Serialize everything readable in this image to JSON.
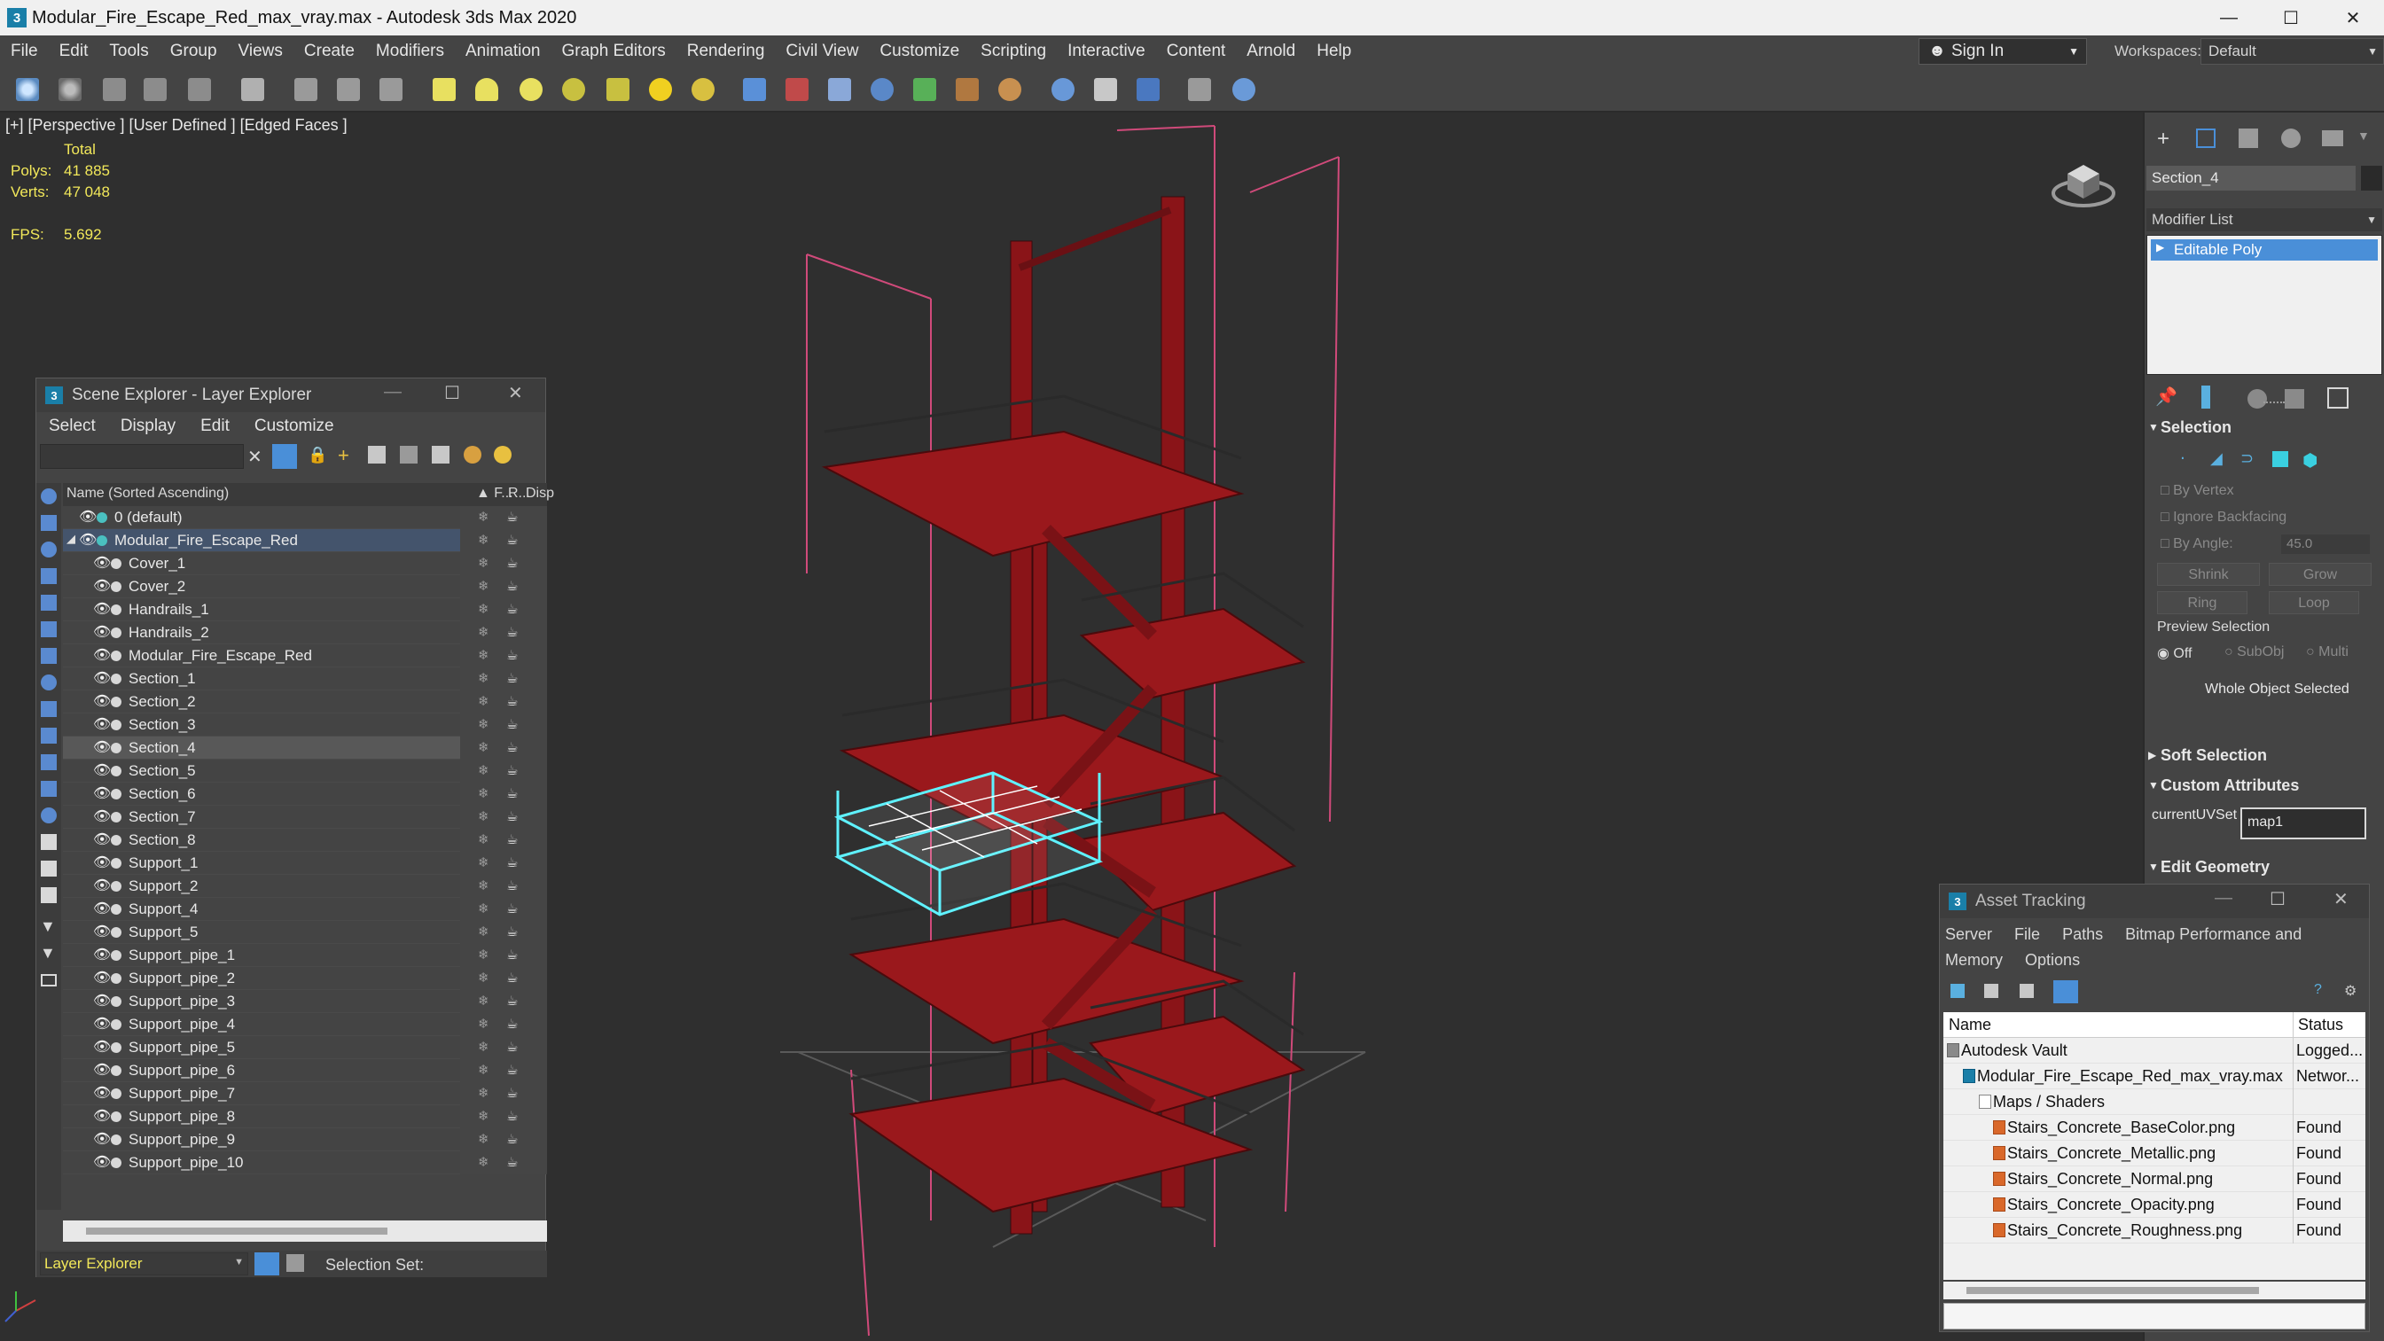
{
  "window": {
    "title": "Modular_Fire_Escape_Red_max_vray.max - Autodesk 3ds Max 2020",
    "app_icon": "3"
  },
  "menubar": {
    "items": [
      "File",
      "Edit",
      "Tools",
      "Group",
      "Views",
      "Create",
      "Modifiers",
      "Animation",
      "Graph Editors",
      "Rendering",
      "Civil View",
      "Customize",
      "Scripting",
      "Interactive",
      "Content",
      "Arnold",
      "Help"
    ],
    "sign_in": "Sign In",
    "workspaces_label": "Workspaces:",
    "workspace_value": "Default"
  },
  "viewport": {
    "label": "[+] [Perspective ] [User Defined ] [Edged Faces ]",
    "stats_total": "Total",
    "polys_label": "Polys:",
    "polys_value": "41 885",
    "verts_label": "Verts:",
    "verts_value": "47 048",
    "fps_label": "FPS:",
    "fps_value": "5.692"
  },
  "command_panel": {
    "object_name": "Section_4",
    "modifier_list": "Modifier List",
    "stack_item": "Editable Poly",
    "selection_rollout": "Selection",
    "by_vertex": "By Vertex",
    "ignore_backfacing": "Ignore Backfacing",
    "by_angle": "By Angle:",
    "by_angle_value": "45.0",
    "shrink": "Shrink",
    "grow": "Grow",
    "ring": "Ring",
    "loop": "Loop",
    "preview_selection": "Preview Selection",
    "preview_off": "Off",
    "preview_subobj": "SubObj",
    "preview_multi": "Multi",
    "whole_object": "Whole Object Selected",
    "soft_selection": "Soft Selection",
    "custom_attributes": "Custom Attributes",
    "current_uv_label": "currentUVSet",
    "current_uv_value": "map1",
    "edit_geometry": "Edit Geometry"
  },
  "scene_explorer": {
    "title": "Scene Explorer - Layer Explorer",
    "menu": [
      "Select",
      "Display",
      "Edit",
      "Customize"
    ],
    "col_name": "Name (Sorted Ascending)",
    "col_f": "▲ F...",
    "col_r": "R...",
    "col_disp": "Disp",
    "layer_default": "0 (default)",
    "layer_main": "Modular_Fire_Escape_Red",
    "objects": [
      "Cover_1",
      "Cover_2",
      "Handrails_1",
      "Handrails_2",
      "Modular_Fire_Escape_Red",
      "Section_1",
      "Section_2",
      "Section_3",
      "Section_4",
      "Section_5",
      "Section_6",
      "Section_7",
      "Section_8",
      "Support_1",
      "Support_2",
      "Support_4",
      "Support_5",
      "Support_pipe_1",
      "Support_pipe_2",
      "Support_pipe_3",
      "Support_pipe_4",
      "Support_pipe_5",
      "Support_pipe_6",
      "Support_pipe_7",
      "Support_pipe_8",
      "Support_pipe_9",
      "Support_pipe_10"
    ],
    "selected": "Section_4",
    "bottom_dropdown": "Layer Explorer",
    "selection_set_label": "Selection Set:"
  },
  "asset_tracking": {
    "title": "Asset Tracking",
    "menu": [
      "Server",
      "File",
      "Paths",
      "Bitmap Performance and Memory",
      "Options"
    ],
    "col_name": "Name",
    "col_status": "Status",
    "rows": [
      {
        "name": "Autodesk Vault",
        "status": "Logged..."
      },
      {
        "name": "Modular_Fire_Escape_Red_max_vray.max",
        "status": "Networ..."
      },
      {
        "name": "Maps / Shaders",
        "status": ""
      },
      {
        "name": "Stairs_Concrete_BaseColor.png",
        "status": "Found"
      },
      {
        "name": "Stairs_Concrete_Metallic.png",
        "status": "Found"
      },
      {
        "name": "Stairs_Concrete_Normal.png",
        "status": "Found"
      },
      {
        "name": "Stairs_Concrete_Opacity.png",
        "status": "Found"
      },
      {
        "name": "Stairs_Concrete_Roughness.png",
        "status": "Found"
      }
    ]
  },
  "colors": {
    "accent_blue": "#4a8fd8",
    "stats_yellow": "#f2e85a",
    "model_red": "#8a1418",
    "selection_cyan": "#5ff2ff"
  }
}
